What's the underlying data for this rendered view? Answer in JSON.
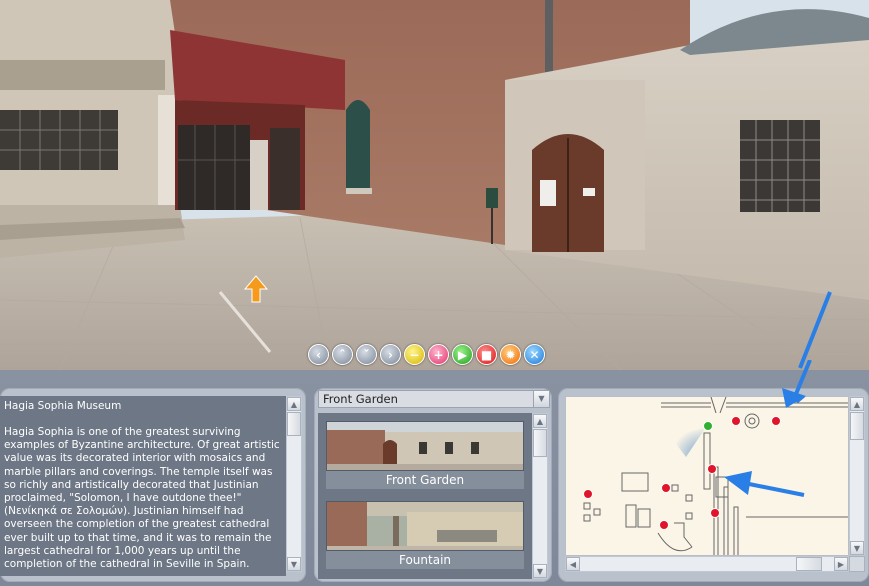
{
  "app": {
    "title": "Hagia Sophia Museum"
  },
  "pano": {
    "nav_buttons": [
      {
        "name": "nav-left-button",
        "icon": "chevron-left-icon",
        "glyph": "‹",
        "style": "gray"
      },
      {
        "name": "nav-up-button",
        "icon": "chevron-up-icon",
        "glyph": "ˆ",
        "style": "gray"
      },
      {
        "name": "nav-down-button",
        "icon": "chevron-down-icon",
        "glyph": "ˇ",
        "style": "gray"
      },
      {
        "name": "nav-right-button",
        "icon": "chevron-right-icon",
        "glyph": "›",
        "style": "gray"
      },
      {
        "name": "zoom-out-button",
        "icon": "minus-icon",
        "glyph": "−",
        "style": "yellow"
      },
      {
        "name": "zoom-in-button",
        "icon": "plus-icon",
        "glyph": "+",
        "style": "pink"
      },
      {
        "name": "play-button",
        "icon": "play-icon",
        "glyph": "▶",
        "style": "green"
      },
      {
        "name": "stop-button",
        "icon": "stop-icon",
        "glyph": "■",
        "style": "red"
      },
      {
        "name": "hotspot-button",
        "icon": "star-icon",
        "glyph": "✹",
        "style": "orange"
      },
      {
        "name": "fullscreen-button",
        "icon": "expand-icon",
        "glyph": "✕",
        "style": "blue"
      }
    ]
  },
  "info": {
    "title": "Hagia Sophia Museum",
    "body": "Hagia Sophia is one of the greatest surviving examples of Byzantine architecture. Of great artistic value was its decorated interior with mosaics and marble pillars and coverings. The temple itself was so richly and artistically decorated that Justinian proclaimed, \"Solomon, I have outdone thee!\" (Νενίκηκά σε Σολομών). Justinian himself had overseen the completion of the greatest cathedral ever built up to that time, and it was to remain the largest cathedral for 1,000 years up until the completion of the cathedral in Seville in Spain."
  },
  "locations": {
    "selected": "Front Garden",
    "items": [
      {
        "label": "Front Garden"
      },
      {
        "label": "Fountain"
      }
    ]
  },
  "colors": {
    "panel": "#b9c1cc",
    "dark_panel": "#6e7785",
    "map_bg": "#fbf5e7",
    "hotspot_red": "#e0142a",
    "hotspot_green": "#30b030",
    "arrow_blue": "#2a7fe6"
  }
}
